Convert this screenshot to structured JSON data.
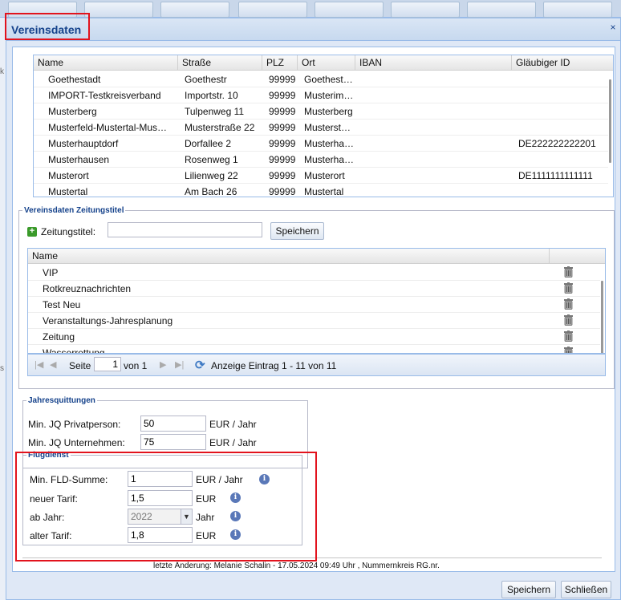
{
  "dialog": {
    "title": "Vereinsdaten",
    "close_symbol": "×"
  },
  "background": {
    "side_chars": [
      "k",
      "s"
    ]
  },
  "vereine_grid": {
    "columns": [
      "Name",
      "Straße",
      "PLZ",
      "Ort",
      "IBAN",
      "Gläubiger ID"
    ],
    "rows": [
      [
        "Goethestadt",
        "Goethestr",
        "99999",
        "Goethest…",
        "",
        ""
      ],
      [
        "IMPORT-Testkreisverband",
        "Importstr. 10",
        "99999",
        "Musterim…",
        "",
        ""
      ],
      [
        "Musterberg",
        "Tulpenweg 11",
        "99999",
        "Musterberg",
        "",
        ""
      ],
      [
        "Musterfeld-Mustertal-Mus…",
        "Musterstraße 22",
        "99999",
        "Musterst…",
        "",
        ""
      ],
      [
        "Musterhauptdorf",
        "Dorfallee 2",
        "99999",
        "Musterha…",
        "",
        "DE222222222201"
      ],
      [
        "Musterhausen",
        "Rosenweg 1",
        "99999",
        "Musterha…",
        "",
        ""
      ],
      [
        "Musterort",
        "Lilienweg 22",
        "99999",
        "Musterort",
        "",
        "DE1111111111111"
      ],
      [
        "Mustertal",
        "Am Bach 26",
        "99999",
        "Mustertal",
        "",
        ""
      ]
    ]
  },
  "zeitungstitel": {
    "legend": "Vereinsdaten Zeitungstitel",
    "input_label": "Zeitungstitel:",
    "input_value": "",
    "save_label": "Speichern",
    "column": "Name",
    "rows": [
      "VIP",
      "Rotkreuznachrichten",
      "Test Neu",
      "Veranstaltungs-Jahresplanung",
      "Zeitung",
      "Wasserrettung"
    ],
    "pager": {
      "page_label": "Seite",
      "page_value": "1",
      "of_label": "von 1",
      "display_text": "Anzeige Eintrag 1 - 11 von 11"
    }
  },
  "jahresquittungen": {
    "legend": "Jahresquittungen",
    "privat_label": "Min. JQ Privatperson:",
    "privat_value": "50",
    "privat_unit": "EUR / Jahr",
    "unternehmen_label": "Min. JQ Unternehmen:",
    "unternehmen_value": "75",
    "unternehmen_unit": "EUR / Jahr"
  },
  "flugdienst": {
    "legend": "Flugdienst",
    "fld_label": "Min. FLD-Summe:",
    "fld_value": "1",
    "fld_unit": "EUR / Jahr",
    "neuer_label": "neuer Tarif:",
    "neuer_value": "1,5",
    "neuer_unit": "EUR",
    "jahr_label": "ab Jahr:",
    "jahr_value": "2022",
    "jahr_unit": "Jahr",
    "alter_label": "alter Tarif:",
    "alter_value": "1,8",
    "alter_unit": "EUR"
  },
  "footer": {
    "last_change": "letzte Änderung: Melanie Schalin - 17.05.2024 09:49 Uhr , Nummernkreis RG.nr.",
    "save_label": "Speichern",
    "close_label": "Schließen"
  },
  "colors": {
    "highlight": "#e2131d",
    "title": "#15428b"
  }
}
